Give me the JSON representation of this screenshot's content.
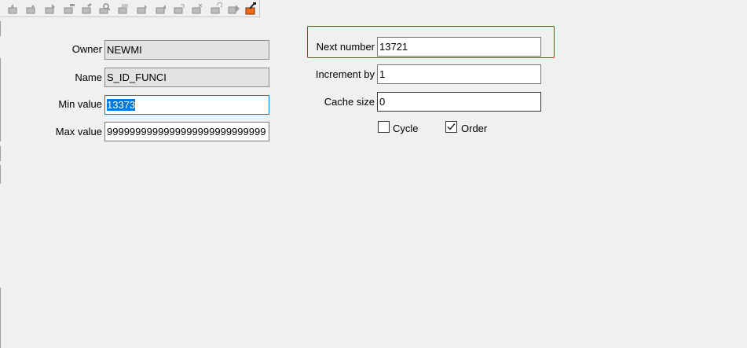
{
  "toolbar": {
    "icons": [
      "first-record-icon",
      "prior-record-icon",
      "insert-record-icon",
      "delete-record-icon",
      "edit-record-icon",
      "find-icon",
      "query-icon",
      "next-icon",
      "prior-icon",
      "post-icon",
      "cancel-icon",
      "refresh-icon",
      "last-icon",
      "tools-icon"
    ]
  },
  "form": {
    "owner_label": "Owner",
    "owner_value": "NEWMI",
    "name_label": "Name",
    "name_value": "S_ID_FUNCI",
    "min_label": "Min value",
    "min_value": "13373",
    "max_label": "Max value",
    "max_value": "9999999999999999999999999999",
    "next_label": "Next number",
    "next_value": "13721",
    "increment_label": "Increment by",
    "increment_value": "1",
    "cache_label": "Cache size",
    "cache_value": "0",
    "cycle_label": "Cycle",
    "cycle_checked": false,
    "order_label": "Order",
    "order_checked": true
  },
  "colors": {
    "highlight": "#e01b1b",
    "selection": "#0078d7",
    "readonly_bg": "#e3e3e3"
  }
}
